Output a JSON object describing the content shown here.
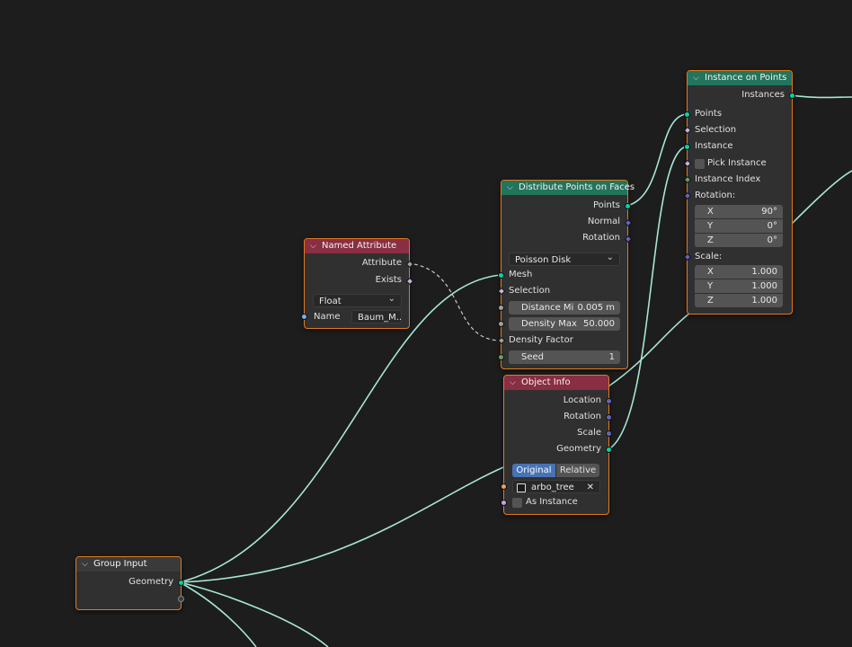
{
  "canvas": {
    "wire_color": "#a8e6d4",
    "node_border": "#e07a1f"
  },
  "nodes": {
    "named_attribute": {
      "title": "Named Attribute",
      "outputs": [
        "Attribute",
        "Exists"
      ],
      "data_type": "Float",
      "name_label": "Name",
      "name_value": "Baum_M..."
    },
    "distribute_points": {
      "title": "Distribute Points on Faces",
      "outputs": [
        "Points",
        "Normal",
        "Rotation"
      ],
      "mode": "Poisson Disk",
      "inputs": [
        "Mesh",
        "Selection"
      ],
      "distance_min_label": "Distance Mi",
      "distance_min_value": "0.005 m",
      "density_max_label": "Density Max",
      "density_max_value": "50.000",
      "density_factor_label": "Density Factor",
      "seed_label": "Seed",
      "seed_value": "1"
    },
    "instance_on_points": {
      "title": "Instance on Points",
      "output": "Instances",
      "inputs": [
        "Points",
        "Selection",
        "Instance"
      ],
      "pick_instance_label": "Pick Instance",
      "instance_index_label": "Instance Index",
      "rotation_label": "Rotation:",
      "rotation": {
        "x_label": "X",
        "x": "90°",
        "y_label": "Y",
        "y": "0°",
        "z_label": "Z",
        "z": "0°"
      },
      "scale_label": "Scale:",
      "scale": {
        "x_label": "X",
        "x": "1.000",
        "y_label": "Y",
        "y": "1.000",
        "z_label": "Z",
        "z": "1.000"
      }
    },
    "object_info": {
      "title": "Object Info",
      "outputs": [
        "Location",
        "Rotation",
        "Scale",
        "Geometry"
      ],
      "transform_original": "Original",
      "transform_relative": "Relative",
      "object_name": "arbo_tree",
      "as_instance_label": "As Instance"
    },
    "group_input": {
      "title": "Group Input",
      "output": "Geometry"
    }
  }
}
